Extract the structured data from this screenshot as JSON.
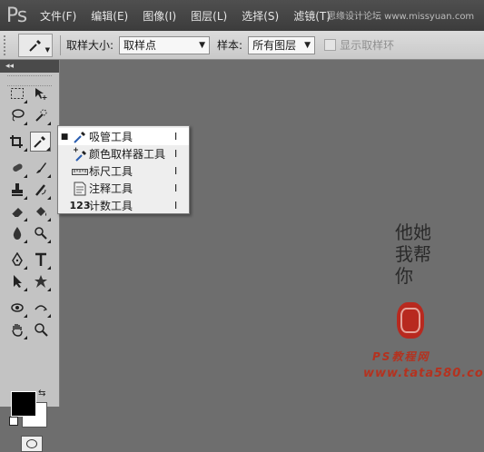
{
  "app": {
    "logo": "Ps"
  },
  "menubar": {
    "items": [
      "文件(F)",
      "编辑(E)",
      "图像(I)",
      "图层(L)",
      "选择(S)",
      "滤镜(T)"
    ],
    "overlay_text": "思缘设计论坛  www.missyuan.com"
  },
  "options": {
    "sample_size_label": "取样大小:",
    "sample_size_value": "取样点",
    "sample_label": "样本:",
    "sample_value": "所有图层",
    "show_ring_label": "显示取样环",
    "show_ring_checked": false,
    "show_ring_disabled": true
  },
  "toolbox": {
    "collapse_glyph": "◂◂",
    "tools": [
      [
        "rectangular-marquee",
        "move"
      ],
      [
        "lasso",
        "quick-selection"
      ],
      [
        "crop",
        "eyedropper"
      ],
      [
        "spot-healing-brush",
        "brush"
      ],
      [
        "clone-stamp",
        "history-brush"
      ],
      [
        "eraser",
        "paint-bucket"
      ],
      [
        "blur",
        "dodge"
      ],
      [
        "pen",
        "type"
      ],
      [
        "path-selection",
        "custom-shape"
      ],
      [
        "3d-rotate",
        "3d-orbit"
      ],
      [
        "hand",
        "zoom"
      ]
    ],
    "active_tool": "eyedropper",
    "foreground_color": "#000000",
    "background_color": "#ffffff"
  },
  "flyout": {
    "items": [
      {
        "label": "吸管工具",
        "key": "I",
        "icon": "eyedropper-icon",
        "selected": true
      },
      {
        "label": "颜色取样器工具",
        "key": "I",
        "icon": "color-sampler-icon",
        "selected": false
      },
      {
        "label": "标尺工具",
        "key": "I",
        "icon": "ruler-icon",
        "selected": false
      },
      {
        "label": "注释工具",
        "key": "I",
        "icon": "note-icon",
        "selected": false
      },
      {
        "label": "计数工具",
        "key": "I",
        "icon": "count-icon",
        "selected": false
      }
    ],
    "count_icon_text": "123"
  },
  "watermark": {
    "calligraphy": "他她我帮你",
    "site_top": "PS教程网",
    "site_bottom": "www.tata580.com"
  }
}
